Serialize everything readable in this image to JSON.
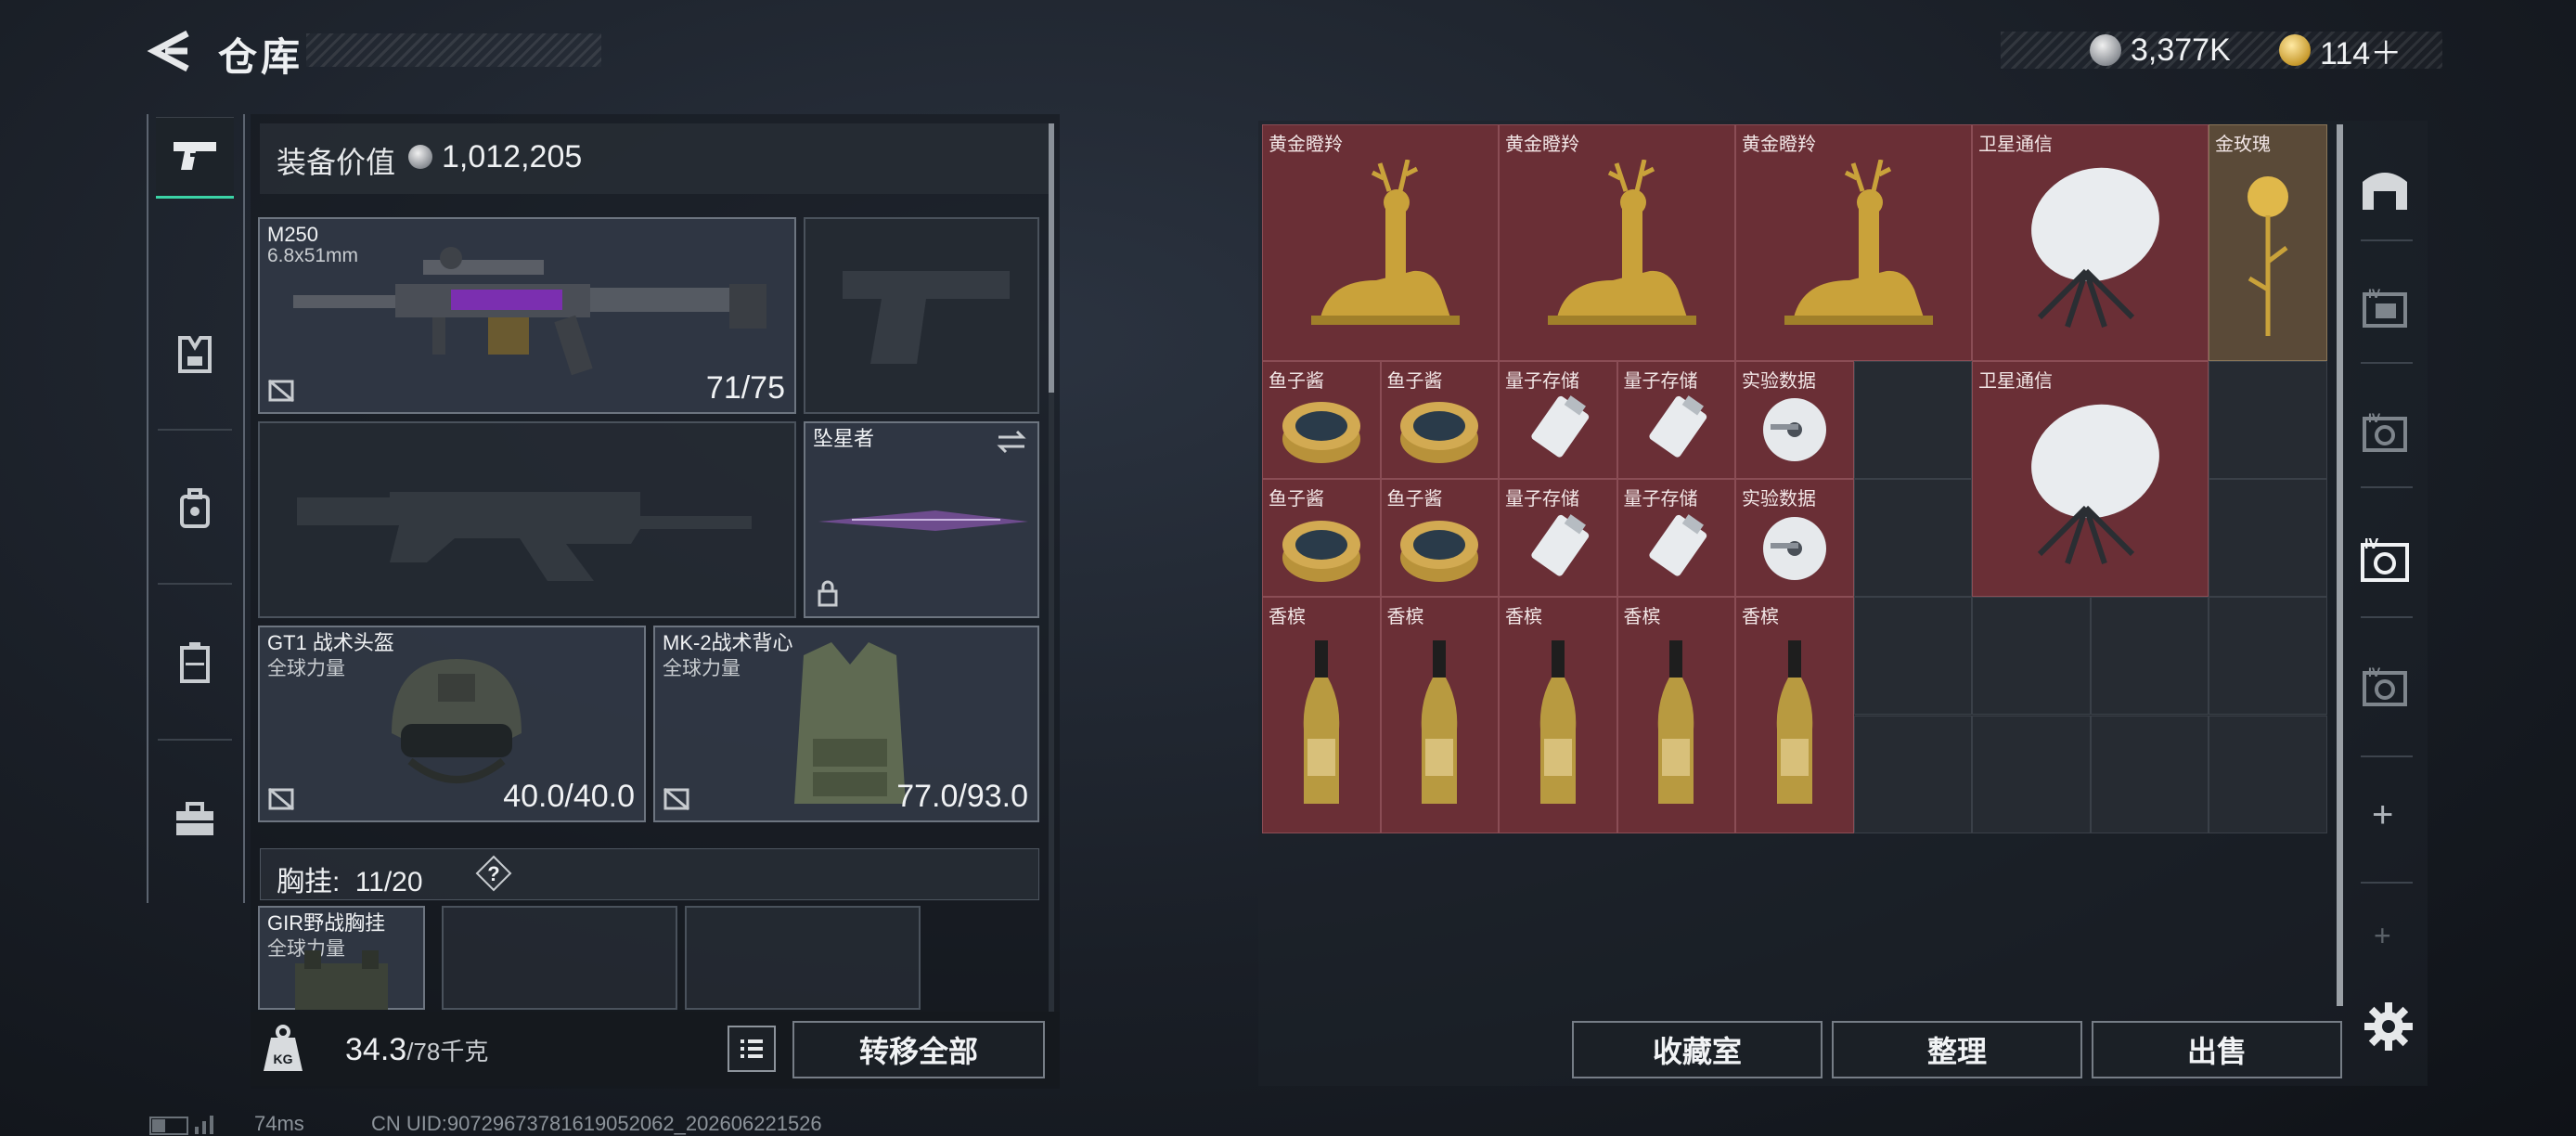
{
  "header": {
    "title": "仓库",
    "currency_silver": "3,377K",
    "currency_gold": "114＋"
  },
  "equipment": {
    "value_label": "装备价值",
    "value": "1,012,205",
    "primary_weapon": {
      "name": "M250",
      "caliber": "6.8x51mm",
      "durability": "71/75"
    },
    "melee": {
      "name": "坠星者"
    },
    "helmet": {
      "name": "GT1 战术头盔",
      "maker": "全球力量",
      "durability": "40.0/40.0"
    },
    "armor": {
      "name": "MK-2战术背心",
      "maker": "全球力量",
      "durability": "77.0/93.0"
    },
    "chest_rig_label": "胸挂:",
    "chest_rig_count": "11",
    "chest_rig_total": "/20",
    "chest_rig_help": "?",
    "chest_item": {
      "name": "GIR野战胸挂",
      "maker": "全球力量"
    }
  },
  "weight": {
    "current": "34.3",
    "max": "/78千克"
  },
  "buttons": {
    "transfer_all": "转移全部",
    "collection": "收藏室",
    "sort": "整理",
    "sell": "出售"
  },
  "stash_items": [
    {
      "label": "黄金瞪羚"
    },
    {
      "label": "黄金瞪羚"
    },
    {
      "label": "黄金瞪羚"
    },
    {
      "label": "卫星通信"
    },
    {
      "label": "金玫瑰"
    },
    {
      "label": "鱼子酱"
    },
    {
      "label": "鱼子酱"
    },
    {
      "label": "量子存储"
    },
    {
      "label": "量子存储"
    },
    {
      "label": "实验数据"
    },
    {
      "label": "卫星通信"
    },
    {
      "label": "鱼子酱"
    },
    {
      "label": "鱼子酱"
    },
    {
      "label": "量子存储"
    },
    {
      "label": "量子存储"
    },
    {
      "label": "实验数据"
    },
    {
      "label": "香槟"
    },
    {
      "label": "香槟"
    },
    {
      "label": "香槟"
    },
    {
      "label": "香槟"
    },
    {
      "label": "香槟"
    }
  ],
  "footer": {
    "ping": "74ms",
    "uid": "CN UID:90729673781619052062_202606221526"
  },
  "icons": [
    "back-arrow-icon",
    "pistol-icon",
    "backpack-armor-icon",
    "bag-icon",
    "case-icon",
    "toolbox-icon",
    "warehouse-icon",
    "safe-icon",
    "settings-icon"
  ]
}
